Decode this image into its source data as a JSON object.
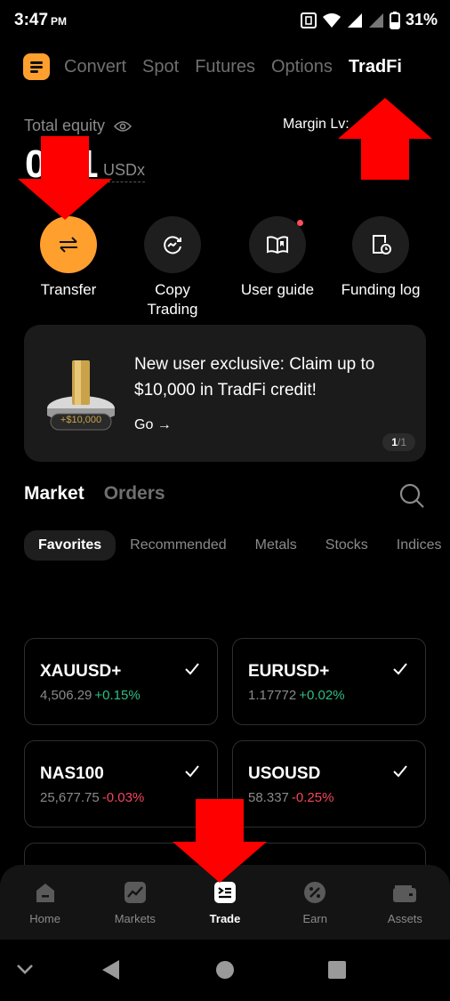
{
  "status_bar": {
    "time": "3:47",
    "ampm": "PM",
    "battery": "31%"
  },
  "top_tabs": [
    "Convert",
    "Spot",
    "Futures",
    "Options",
    "TradFi"
  ],
  "equity": {
    "label": "Total equity",
    "value": "0.01",
    "unit": "USDx",
    "margin_label": "Margin Lv:"
  },
  "actions": [
    {
      "label": "Transfer",
      "icon": "transfer-icon"
    },
    {
      "label": "Copy\nTrading",
      "icon": "copy-trading-icon"
    },
    {
      "label": "User guide",
      "icon": "user-guide-icon"
    },
    {
      "label": "Funding log",
      "icon": "funding-log-icon"
    }
  ],
  "promo": {
    "title": "New user exclusive: Claim up to $10,000 in TradFi credit!",
    "go": "Go →",
    "badge": "+$10,000",
    "page": "1",
    "total": "/1"
  },
  "market": {
    "tab_market": "Market",
    "tab_orders": "Orders"
  },
  "chips": [
    "Favorites",
    "Recommended",
    "Metals",
    "Stocks",
    "Indices"
  ],
  "cards": [
    {
      "symbol": "XAUUSD+",
      "price": "4,506.29",
      "change": "+0.15%",
      "direction": "up"
    },
    {
      "symbol": "EURUSD+",
      "price": "1.17772",
      "change": "+0.02%",
      "direction": "up"
    },
    {
      "symbol": "NAS100",
      "price": "25,677.75",
      "change": "-0.03%",
      "direction": "down"
    },
    {
      "symbol": "USOUSD",
      "price": "58.337",
      "change": "-0.25%",
      "direction": "down"
    }
  ],
  "bottom_nav": [
    "Home",
    "Markets",
    "Trade",
    "Earn",
    "Assets"
  ],
  "colors": {
    "accent": "#ff9f2e",
    "positive": "#2ebd85",
    "negative": "#f6465d",
    "arrow": "#ff0000"
  }
}
